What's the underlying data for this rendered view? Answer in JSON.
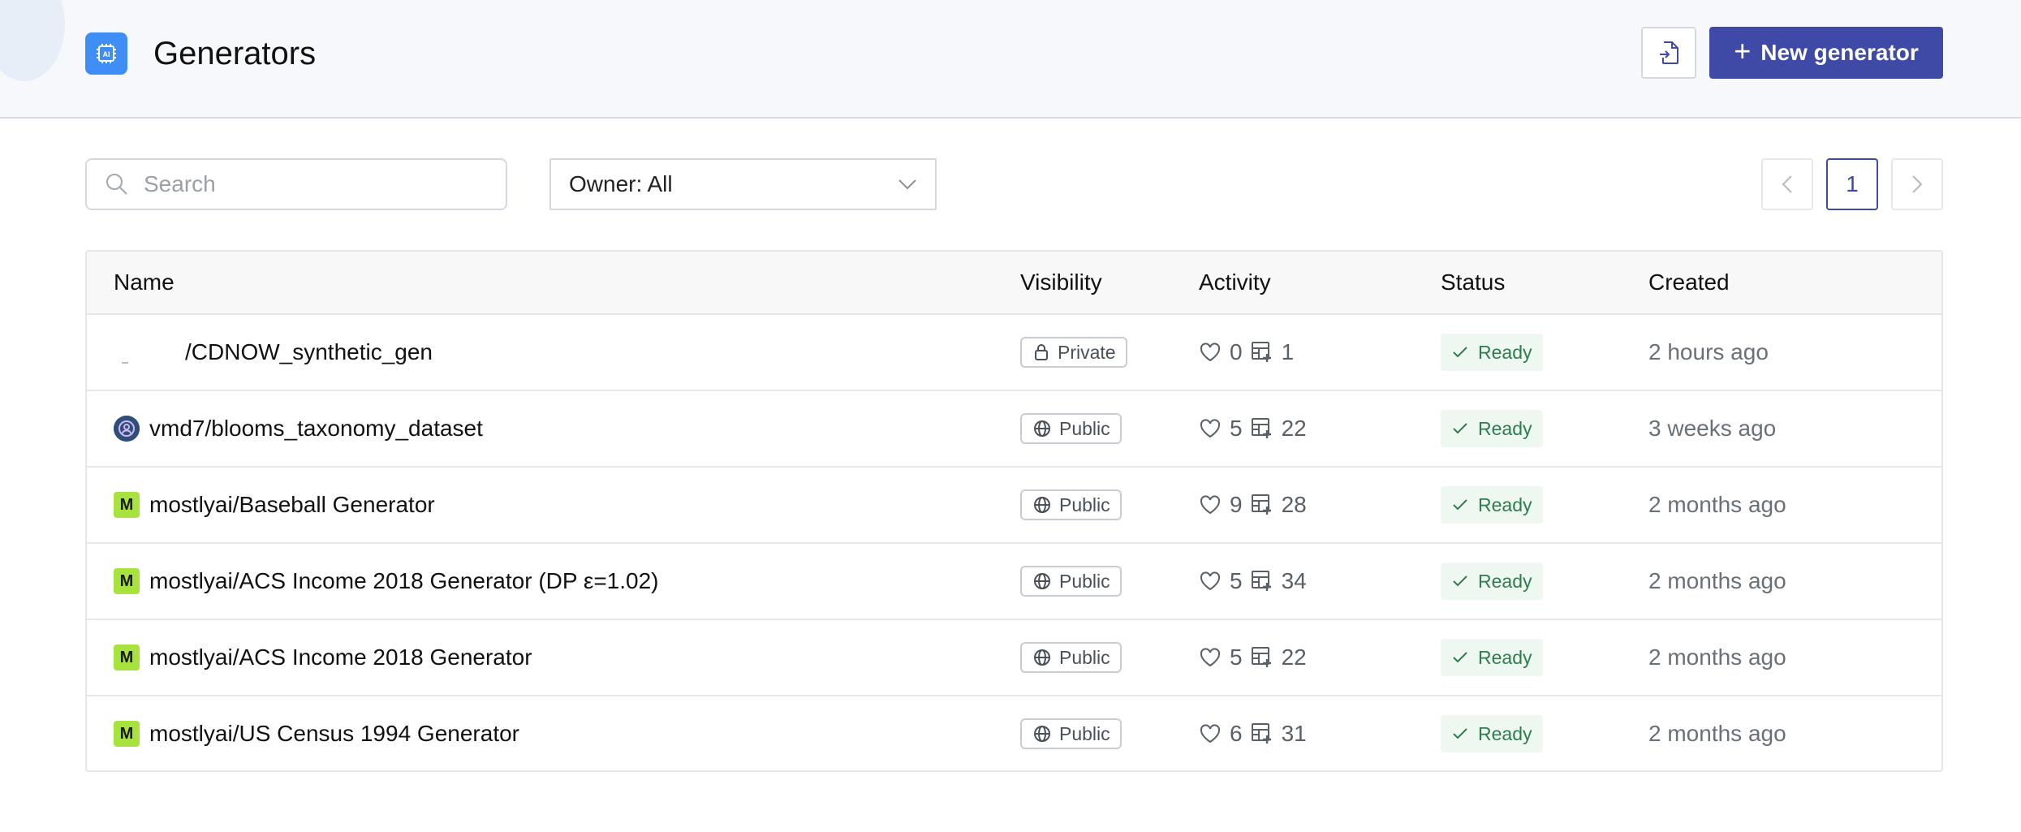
{
  "header": {
    "title": "Generators",
    "new_button_label": "New generator",
    "accent_color": "#3f4aa6",
    "app_icon_color": "#3f8ef5"
  },
  "toolbar": {
    "search_placeholder": "Search",
    "owner_filter": "Owner: All",
    "current_page": "1"
  },
  "table": {
    "columns": [
      "Name",
      "Visibility",
      "Activity",
      "Status",
      "Created"
    ],
    "rows": [
      {
        "name": "/CDNOW_synthetic_gen",
        "owner_avatar": "blank",
        "visibility": "Private",
        "likes": "0",
        "datasets": "1",
        "status": "Ready",
        "created": "2 hours ago"
      },
      {
        "name": "vmd7/blooms_taxonomy_dataset",
        "owner_avatar": "user-icon",
        "visibility": "Public",
        "likes": "5",
        "datasets": "22",
        "status": "Ready",
        "created": "3 weeks ago"
      },
      {
        "name": "mostlyai/Baseball Generator",
        "owner_avatar": "M",
        "visibility": "Public",
        "likes": "9",
        "datasets": "28",
        "status": "Ready",
        "created": "2 months ago"
      },
      {
        "name": "mostlyai/ACS Income 2018 Generator (DP ε=1.02)",
        "owner_avatar": "M",
        "visibility": "Public",
        "likes": "5",
        "datasets": "34",
        "status": "Ready",
        "created": "2 months ago"
      },
      {
        "name": "mostlyai/ACS Income 2018 Generator",
        "owner_avatar": "M",
        "visibility": "Public",
        "likes": "5",
        "datasets": "22",
        "status": "Ready",
        "created": "2 months ago"
      },
      {
        "name": "mostlyai/US Census 1994 Generator",
        "owner_avatar": "M",
        "visibility": "Public",
        "likes": "6",
        "datasets": "31",
        "status": "Ready",
        "created": "2 months ago"
      }
    ]
  },
  "colors": {
    "status_ready": "#2e7d4f",
    "status_ready_bg": "#eef7f0",
    "owner_badge_m": "#a8e23d"
  }
}
